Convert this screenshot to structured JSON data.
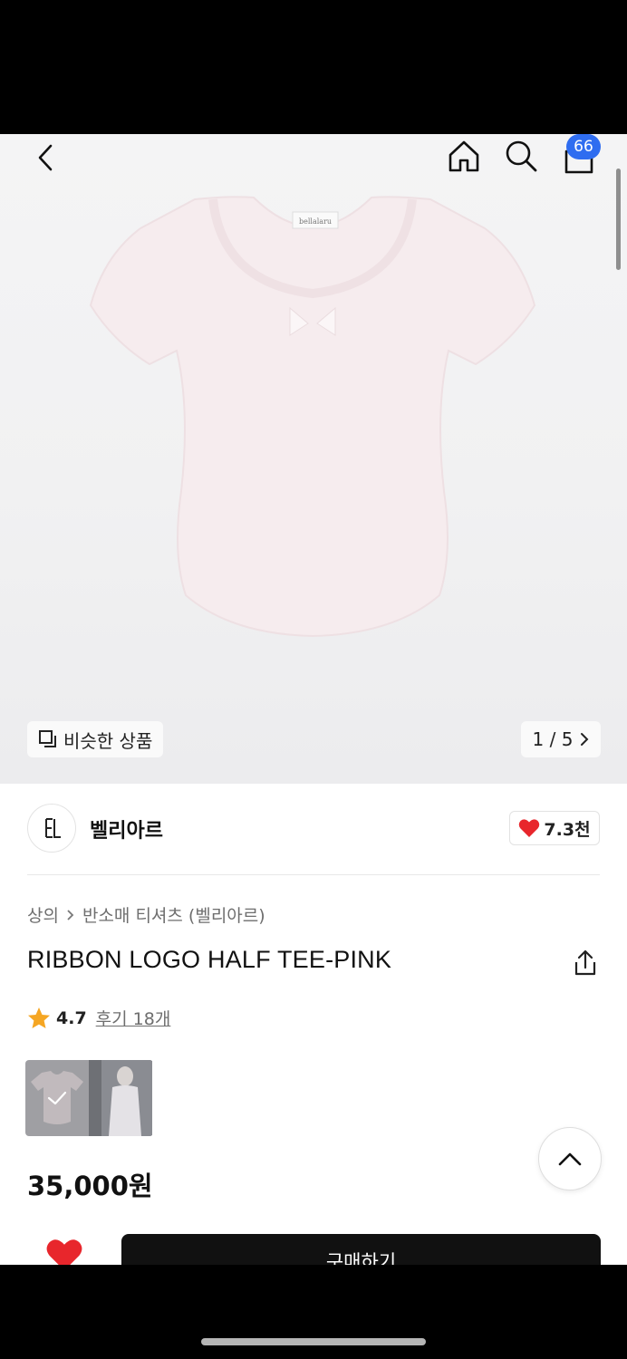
{
  "header": {
    "cart_count": "66"
  },
  "gallery": {
    "similar_label": "비슷한 상품",
    "pager": "1 / 5",
    "tag_text": "bellalaru"
  },
  "brand": {
    "name": "벨리아르",
    "likes": "7.3천",
    "accent": "#e8262c"
  },
  "breadcrumb": {
    "items": [
      "상의",
      "반소매 티셔츠 (벨리아르)"
    ]
  },
  "product": {
    "title": "RIBBON LOGO HALF TEE-PINK",
    "rating": "4.7",
    "reviews": "후기 18개",
    "price": "35,000원",
    "tee_color": "#f7edef"
  },
  "footer": {
    "buy_label": "구매하기"
  },
  "icons": [
    "back-icon",
    "home-icon",
    "search-icon",
    "cart-icon",
    "similar-icon",
    "chevron-right-icon",
    "heart-icon",
    "chevron-icon",
    "share-icon",
    "star-icon",
    "check-icon",
    "chevron-up-icon"
  ]
}
